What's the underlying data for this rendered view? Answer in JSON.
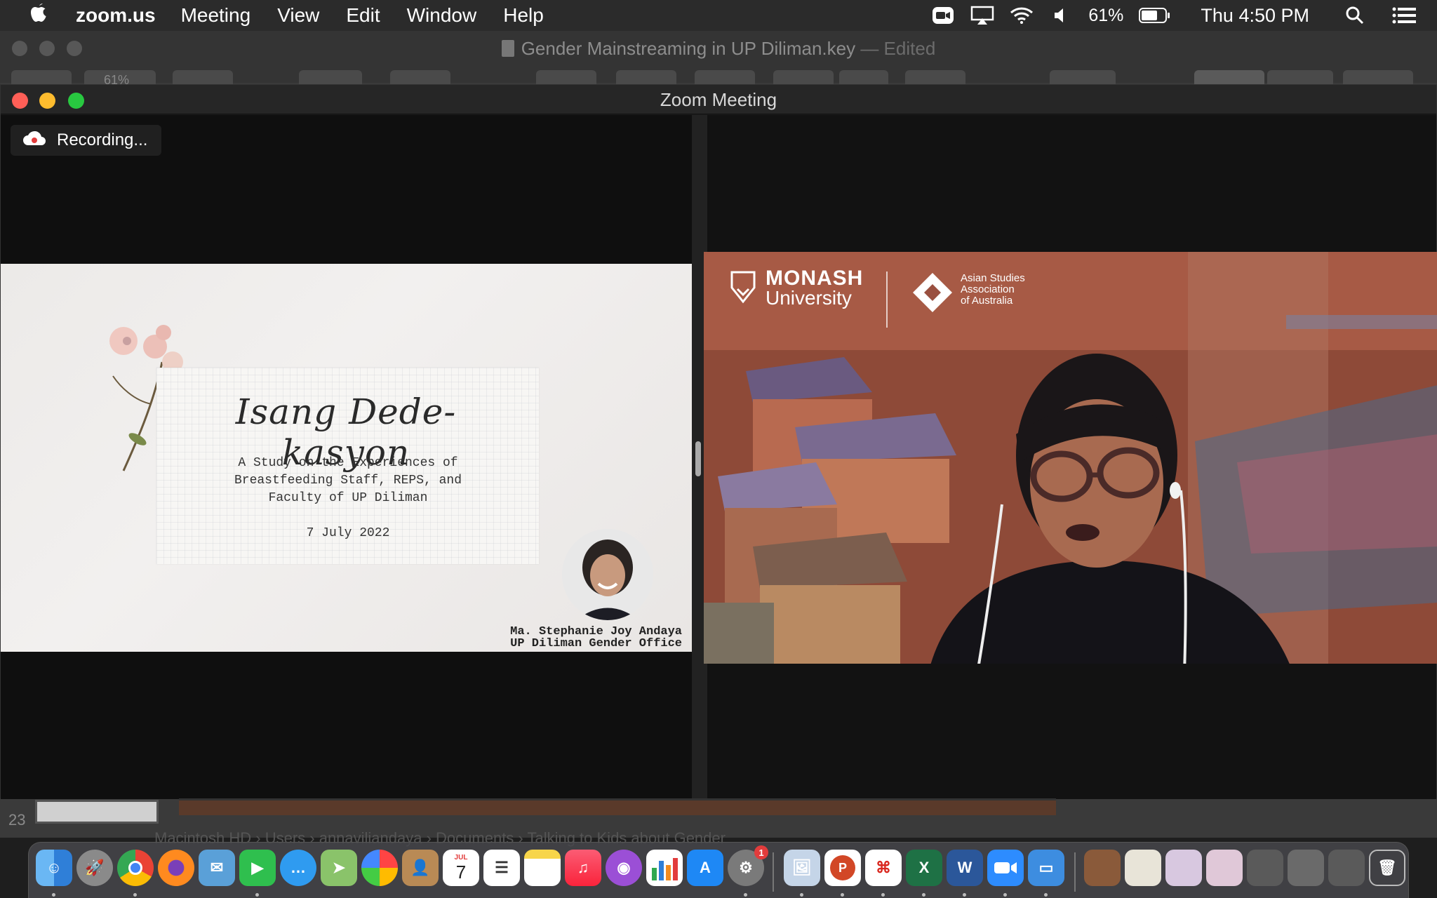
{
  "menubar": {
    "app_name": "zoom.us",
    "menus": [
      "Meeting",
      "View",
      "Edit",
      "Window",
      "Help"
    ],
    "battery_percent": "61%",
    "clock": "Thu 4:50 PM",
    "icons": [
      "zoom-status-icon",
      "airplay-icon",
      "wifi-icon",
      "volume-icon",
      "battery-icon",
      "spotlight-search-icon",
      "control-center-icon"
    ]
  },
  "keynote": {
    "document_title": "Gender Mainstreaming in UP Diliman.key",
    "edited_suffix": "— Edited",
    "zoom_level": "61%",
    "slide_number": "23",
    "pathbar": "Macintosh HD  ›  Users  ›  annaviliandaya  ›  Documents  ›  Talking to Kids about Gender"
  },
  "zoom": {
    "window_title": "Zoom Meeting",
    "recording_label": "Recording...",
    "slide": {
      "title": "Isang Dede-kasyon",
      "subtitle_lines": [
        "A Study on the Experiences of",
        "Breastfeeding Staff, REPS, and",
        "Faculty of UP Diliman"
      ],
      "date": "7 July 2022",
      "presenter_name": "Ma. Stephanie Joy Andaya",
      "presenter_office": "UP Diliman Gender Office"
    },
    "video": {
      "background_logo_line1": "MONASH",
      "background_logo_line2": "University",
      "partner_logo_text": [
        "Asian Studies",
        "Association",
        "of Australia"
      ]
    }
  },
  "dock": {
    "apps": [
      "finder-icon",
      "launchpad-icon",
      "chrome-icon",
      "firefox-icon",
      "mail-icon",
      "facetime-icon",
      "messages-icon",
      "maps-icon",
      "photos-icon",
      "contacts-icon",
      "calendar-icon",
      "reminders-icon",
      "notes-icon",
      "music-icon",
      "podcasts-icon",
      "numbers-icon",
      "app-store-icon",
      "system-preferences-icon",
      "preview-icon",
      "powerpoint-icon",
      "acrobat-icon",
      "excel-icon",
      "word-icon",
      "zoom-icon",
      "keynote-icon"
    ],
    "calendar_month": "JUL",
    "calendar_day": "7",
    "settings_badge": "1"
  },
  "colors": {
    "close": "#ff5f57",
    "minimize": "#febc2e",
    "maximize": "#28c840",
    "recording_dot": "#e23c3c"
  }
}
